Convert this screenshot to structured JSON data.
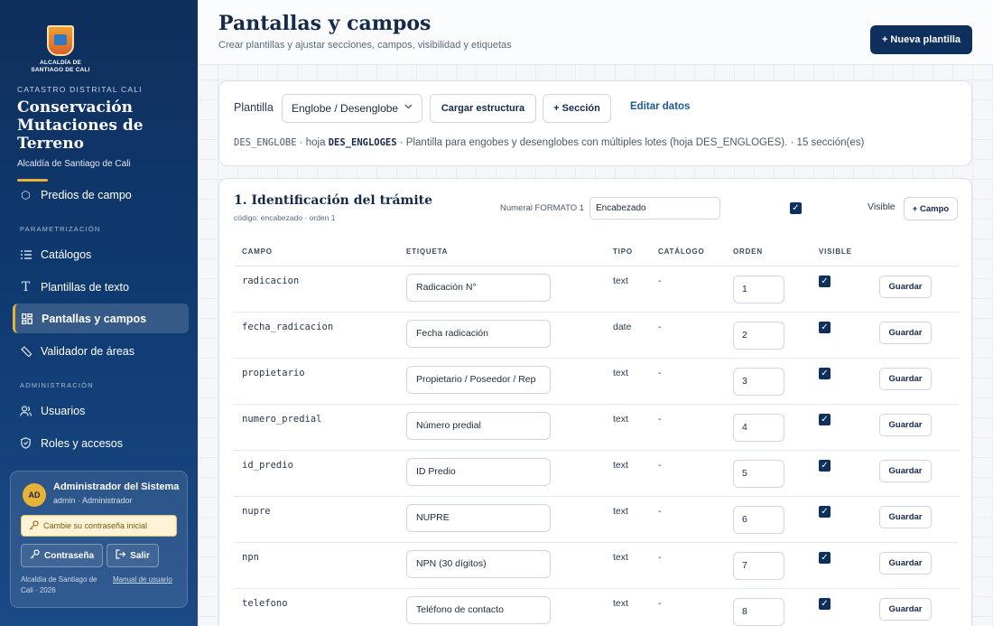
{
  "sidebar": {
    "logo_line1": "ALCALDÍA DE",
    "logo_line2": "SANTIAGO DE CALI",
    "eyebrow": "CATASTRO DISTRITAL CALI",
    "title": "Conservación Mutaciones de Terreno",
    "subtitle": "Alcaldía de Santiago de Cali",
    "nav_partial": "Predios de campo",
    "section_param": "PARAMETRIZACIÓN",
    "section_admin": "ADMINISTRACIÓN",
    "items": [
      {
        "label": "Catálogos",
        "icon": "list-icon"
      },
      {
        "label": "Plantillas de texto",
        "icon": "text-icon"
      },
      {
        "label": "Pantallas y campos",
        "icon": "grid-icon"
      },
      {
        "label": "Validador de áreas",
        "icon": "ruler-icon"
      },
      {
        "label": "Usuarios",
        "icon": "users-icon"
      },
      {
        "label": "Roles y accesos",
        "icon": "shield-icon"
      }
    ],
    "user": {
      "initials": "AD",
      "name": "Administrador del Sistema",
      "role": "admin · Administrador",
      "alert": "Cambie su contraseña inicial",
      "password_btn": "Contraseña",
      "logout_btn": "Salir",
      "footer": "Alcaldía de Santiago de Cali · 2026",
      "manual_link": "Manual de usuario"
    }
  },
  "header": {
    "title": "Pantallas y campos",
    "subtitle": "Crear plantillas y ajustar secciones, campos, visibilidad y etiquetas",
    "new_template_btn": "+ Nueva plantilla"
  },
  "template_bar": {
    "label": "Plantilla",
    "selected": "Englobe / Desenglobe",
    "load_btn": "Cargar estructura",
    "add_section_btn": "+ Sección",
    "edit_link": "Editar datos",
    "meta_code": "DES_ENGLOBE",
    "meta_sheet_prefix": " · hoja ",
    "meta_sheet": "DES_ENGLOGES",
    "meta_desc": " · Plantilla para engobes y desenglobes con múltiples lotes (hoja DES_ENGLOGES). · 15 sección(es)"
  },
  "section": {
    "title": "1. Identificación del trámite",
    "sub": "código: encabezado · orden 1",
    "numeral_label": "Numeral FORMATO 1",
    "numeral_value": "Encabezado",
    "visible_label": "Visible",
    "add_field_btn": "+ Campo",
    "columns": {
      "campo": "CAMPO",
      "etiqueta": "ETIQUETA",
      "tipo": "TIPO",
      "catalogo": "CATÁLOGO",
      "orden": "ORDEN",
      "visible": "VISIBLE"
    },
    "save_label": "Guardar",
    "rows": [
      {
        "campo": "radicacion",
        "etiqueta": "Radicación N°",
        "tipo": "text",
        "catalogo": "-",
        "orden": "1"
      },
      {
        "campo": "fecha_radicacion",
        "etiqueta": "Fecha radicación",
        "tipo": "date",
        "catalogo": "-",
        "orden": "2"
      },
      {
        "campo": "propietario",
        "etiqueta": "Propietario / Poseedor / Rep",
        "tipo": "text",
        "catalogo": "-",
        "orden": "3"
      },
      {
        "campo": "numero_predial",
        "etiqueta": "Número predial",
        "tipo": "text",
        "catalogo": "-",
        "orden": "4"
      },
      {
        "campo": "id_predio",
        "etiqueta": "ID Predio",
        "tipo": "text",
        "catalogo": "-",
        "orden": "5"
      },
      {
        "campo": "nupre",
        "etiqueta": "NUPRE",
        "tipo": "text",
        "catalogo": "-",
        "orden": "6"
      },
      {
        "campo": "npn",
        "etiqueta": "NPN (30 dígitos)",
        "tipo": "text",
        "catalogo": "-",
        "orden": "7"
      },
      {
        "campo": "telefono",
        "etiqueta": "Teléfono de contacto",
        "tipo": "text",
        "catalogo": "-",
        "orden": "8"
      }
    ]
  }
}
